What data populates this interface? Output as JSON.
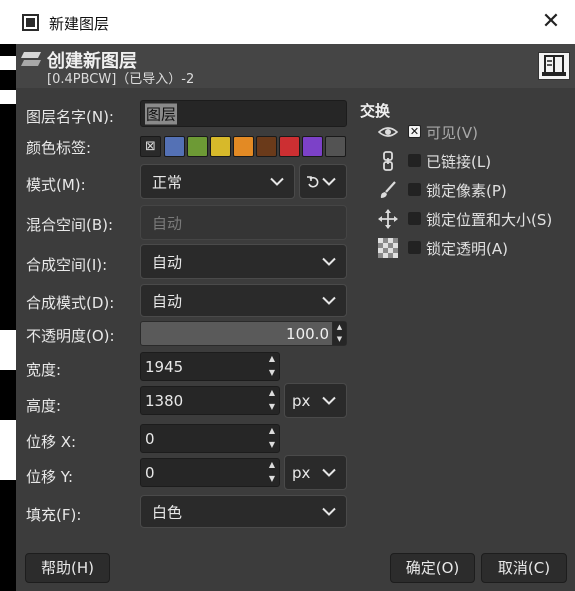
{
  "window": {
    "title": "新建图层",
    "close_glyph": "✕"
  },
  "header": {
    "title": "创建新图层",
    "subtitle": "[0.4PBCW]（已导入）-2"
  },
  "fields": {
    "name_label": "图层名字(N):",
    "name_value": "图层",
    "color_tag_label": "颜色标签:",
    "color_tags": [
      {
        "color": "none",
        "glyph": "⊠"
      },
      {
        "color": "#5471b5"
      },
      {
        "color": "#6d9a35"
      },
      {
        "color": "#d7b92a"
      },
      {
        "color": "#e38a24"
      },
      {
        "color": "#6a3a1a"
      },
      {
        "color": "#cc2f32"
      },
      {
        "color": "#7c41c8"
      },
      {
        "color": "#535353"
      }
    ],
    "mode_label": "模式(M):",
    "mode_value": "正常",
    "blend_space_label": "混合空间(B):",
    "blend_space_value": "自动",
    "composite_space_label": "合成空间(I):",
    "composite_space_value": "自动",
    "composite_mode_label": "合成模式(D):",
    "composite_mode_value": "自动",
    "opacity_label": "不透明度(O):",
    "opacity_value": "100.0",
    "width_label": "宽度:",
    "width_value": "1945",
    "height_label": "高度:",
    "height_value": "1380",
    "size_unit": "px",
    "offset_x_label": "位移 X:",
    "offset_x_value": "0",
    "offset_y_label": "位移 Y:",
    "offset_y_value": "0",
    "offset_unit": "px",
    "fill_label": "填充(F):",
    "fill_value": "白色"
  },
  "switches": {
    "title": "交换",
    "items": [
      {
        "label": "可见(V)",
        "checked": true,
        "icon": "eye-icon"
      },
      {
        "label": "已链接(L)",
        "checked": false,
        "icon": "chain-icon"
      },
      {
        "label": "锁定像素(P)",
        "checked": false,
        "icon": "brush-icon"
      },
      {
        "label": "锁定位置和大小(S)",
        "checked": false,
        "icon": "move-icon"
      },
      {
        "label": "锁定透明(A)",
        "checked": false,
        "icon": "checkerboard-icon"
      }
    ]
  },
  "buttons": {
    "help": "帮助(H)",
    "ok": "确定(O)",
    "cancel": "取消(C)"
  }
}
